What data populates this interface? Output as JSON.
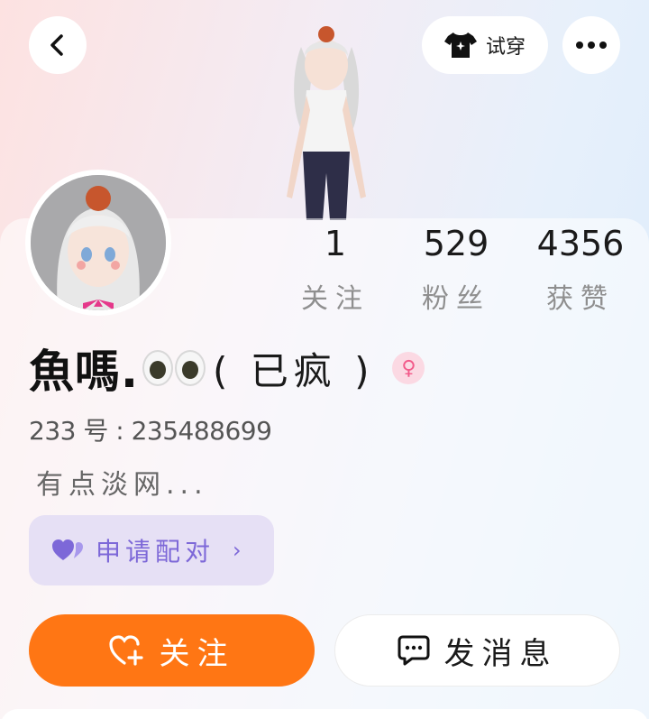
{
  "header": {
    "back_icon": "chevron-left-icon",
    "try_on_label": "试穿",
    "try_on_icon": "tshirt-sparkle-icon",
    "more_icon": "more-dots-icon"
  },
  "stats": [
    {
      "value": "1",
      "label": "关注"
    },
    {
      "value": "529",
      "label": "粉丝"
    },
    {
      "value": "4356",
      "label": "获赞"
    }
  ],
  "profile": {
    "name_main": "魚嗎.",
    "name_tail": "( 已疯 )",
    "gender_icon": "female-icon",
    "id_line": "233 号 : 235488699",
    "bio": "有点淡网..."
  },
  "pair_button": {
    "label": "申请配对",
    "icon": "hearts-icon",
    "chevron": "›"
  },
  "actions": {
    "follow_label": "关注",
    "follow_icon": "heart-plus-icon",
    "message_label": "发消息",
    "message_icon": "chat-bubble-icon"
  },
  "colors": {
    "accent_orange": "#ff7614",
    "pair_purple": "#7d68d8",
    "pair_bg": "#e6e0f5",
    "female_pink": "#f25a8a"
  }
}
